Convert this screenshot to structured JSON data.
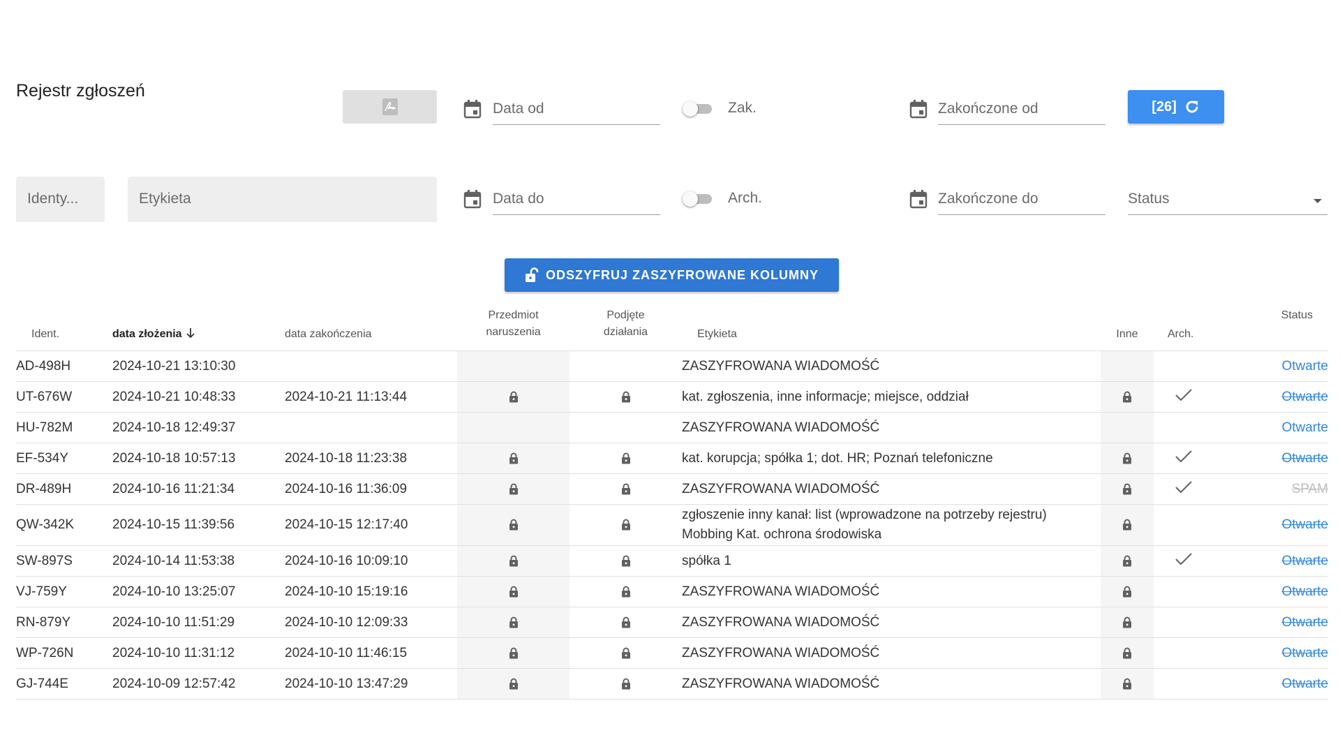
{
  "page": {
    "title": "Rejestr zgłoszeń"
  },
  "toolbar": {
    "pdf_icon": "pdf-icon",
    "date_from_placeholder": "Data od",
    "date_to_placeholder": "Data do",
    "completed_toggle_label": "Zak.",
    "archived_toggle_label": "Arch.",
    "completed_from_placeholder": "Zakończone od",
    "completed_to_placeholder": "Zakończone do",
    "refresh_label": "[26]",
    "identifier_placeholder": "Identy...",
    "label_placeholder": "Etykieta",
    "status_placeholder": "Status",
    "decrypt_label": "ODSZYFRUJ ZASZYFROWANE KOLUMNY"
  },
  "colors": {
    "accent": "#3d8ff0",
    "decrypt": "#2f78d4",
    "link": "#2f86e0"
  },
  "table": {
    "columns": {
      "ident": "Ident.",
      "submitted": "data złożenia",
      "completed": "data zakończenia",
      "subject_line1": "Przedmiot",
      "subject_line2": "naruszenia",
      "actions_line1": "Podjęte",
      "actions_line2": "działania",
      "label": "Etykieta",
      "other": "Inne",
      "archived": "Arch.",
      "status": "Status"
    },
    "rows": [
      {
        "ident": "AD-498H",
        "submitted": "2024-10-21 13:10:30",
        "completed": "",
        "locked": false,
        "label": "ZASZYFROWANA WIADOMOŚĆ",
        "label2": "",
        "archived": false,
        "status": "Otwarte",
        "status_style": "open"
      },
      {
        "ident": "UT-676W",
        "submitted": "2024-10-21 10:48:33",
        "completed": "2024-10-21 11:13:44",
        "locked": true,
        "label": "kat. zgłoszenia, inne informacje; miejsce, oddział",
        "label2": "",
        "archived": true,
        "status": "Otwarte",
        "status_style": "open-strike"
      },
      {
        "ident": "HU-782M",
        "submitted": "2024-10-18 12:49:37",
        "completed": "",
        "locked": false,
        "label": "ZASZYFROWANA WIADOMOŚĆ",
        "label2": "",
        "archived": false,
        "status": "Otwarte",
        "status_style": "open"
      },
      {
        "ident": "EF-534Y",
        "submitted": "2024-10-18 10:57:13",
        "completed": "2024-10-18 11:23:38",
        "locked": true,
        "label": "kat. korupcja; spółka 1; dot. HR; Poznań telefoniczne",
        "label2": "",
        "archived": true,
        "status": "Otwarte",
        "status_style": "open-strike"
      },
      {
        "ident": "DR-489H",
        "submitted": "2024-10-16 11:21:34",
        "completed": "2024-10-16 11:36:09",
        "locked": true,
        "label": "ZASZYFROWANA WIADOMOŚĆ",
        "label2": "",
        "archived": true,
        "status": "SPAM",
        "status_style": "spam"
      },
      {
        "ident": "QW-342K",
        "submitted": "2024-10-15 11:39:56",
        "completed": "2024-10-15 12:17:40",
        "locked": true,
        "label": "zgłoszenie inny kanał: list (wprowadzone na potrzeby rejestru)",
        "label2": "Mobbing Kat. ochrona środowiska",
        "archived": false,
        "status": "Otwarte",
        "status_style": "open-strike"
      },
      {
        "ident": "SW-897S",
        "submitted": "2024-10-14 11:53:38",
        "completed": "2024-10-16 10:09:10",
        "locked": true,
        "label": "spółka 1",
        "label2": "",
        "archived": true,
        "status": "Otwarte",
        "status_style": "open-strike"
      },
      {
        "ident": "VJ-759Y",
        "submitted": "2024-10-10 13:25:07",
        "completed": "2024-10-10 15:19:16",
        "locked": true,
        "label": "ZASZYFROWANA WIADOMOŚĆ",
        "label2": "",
        "archived": false,
        "status": "Otwarte",
        "status_style": "open-strike"
      },
      {
        "ident": "RN-879Y",
        "submitted": "2024-10-10 11:51:29",
        "completed": "2024-10-10 12:09:33",
        "locked": true,
        "label": "ZASZYFROWANA WIADOMOŚĆ",
        "label2": "",
        "archived": false,
        "status": "Otwarte",
        "status_style": "open-strike"
      },
      {
        "ident": "WP-726N",
        "submitted": "2024-10-10 11:31:12",
        "completed": "2024-10-10 11:46:15",
        "locked": true,
        "label": "ZASZYFROWANA WIADOMOŚĆ",
        "label2": "",
        "archived": false,
        "status": "Otwarte",
        "status_style": "open-strike"
      },
      {
        "ident": "GJ-744E",
        "submitted": "2024-10-09 12:57:42",
        "completed": "2024-10-10 13:47:29",
        "locked": true,
        "label": "ZASZYFROWANA WIADOMOŚĆ",
        "label2": "",
        "archived": false,
        "status": "Otwarte",
        "status_style": "open-strike"
      }
    ]
  }
}
